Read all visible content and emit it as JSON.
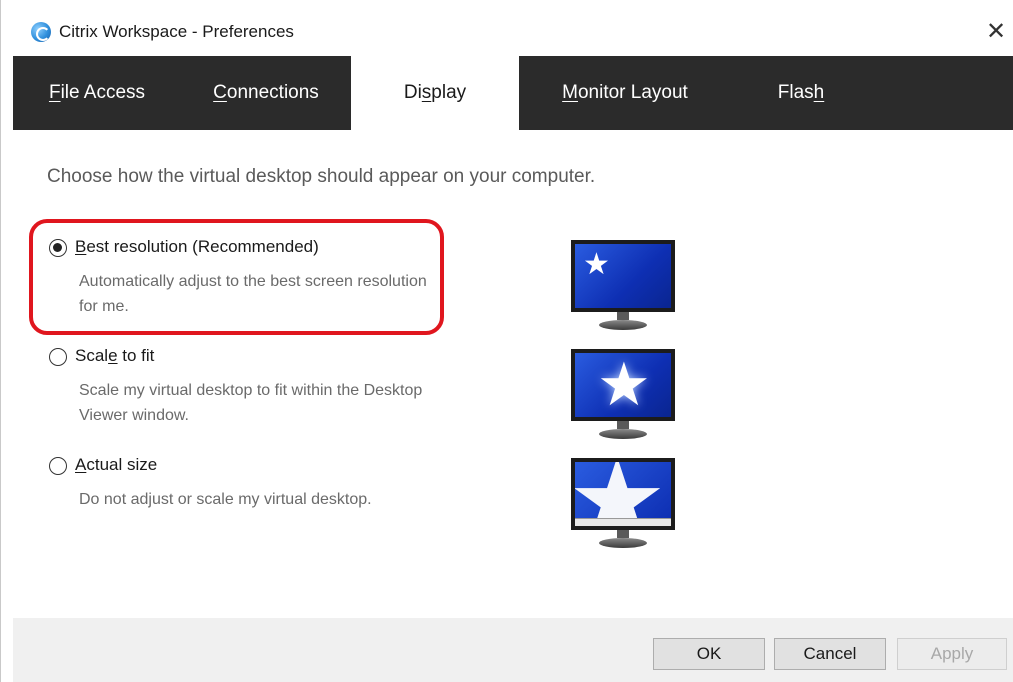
{
  "window": {
    "title": "Citrix Workspace - Preferences",
    "icon": "citrix-app-icon",
    "close_glyph": "✕"
  },
  "tabs": [
    {
      "label_before": "",
      "label_ul": "F",
      "label_after": "ile Access",
      "active": false
    },
    {
      "label_before": "",
      "label_ul": "C",
      "label_after": "onnections",
      "active": false
    },
    {
      "label_before": "Di",
      "label_ul": "s",
      "label_after": "play",
      "active": true
    },
    {
      "label_before": "",
      "label_ul": "M",
      "label_after": "onitor Layout",
      "active": false
    },
    {
      "label_before": "Flas",
      "label_ul": "h",
      "label_after": "",
      "active": false
    }
  ],
  "display": {
    "intro": "Choose how the virtual desktop should appear on your computer.",
    "options": [
      {
        "label_before": "",
        "label_ul": "B",
        "label_after": "est resolution (Recommended)",
        "description": "Automatically adjust to the best screen resolution for me.",
        "selected": true
      },
      {
        "label_before": "Scal",
        "label_ul": "e",
        "label_after": " to fit",
        "description": "Scale my virtual desktop to fit within the Desktop Viewer window.",
        "selected": false
      },
      {
        "label_before": "",
        "label_ul": "A",
        "label_after": "ctual size",
        "description": "Do not adjust or scale my virtual desktop.",
        "selected": false
      }
    ],
    "star_glyph": "★"
  },
  "footer": {
    "ok_label": "OK",
    "cancel_label": "Cancel",
    "apply_label": "Apply",
    "apply_enabled": false
  },
  "colors": {
    "tab_bar": "#2b2b2b",
    "highlight": "#e0161e",
    "monitor_screen": "#0e2fb3"
  }
}
